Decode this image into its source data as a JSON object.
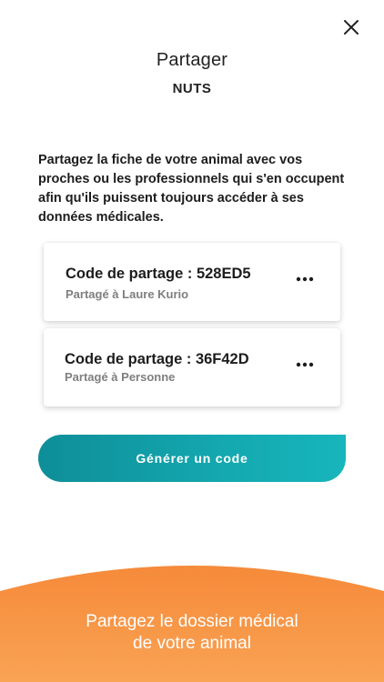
{
  "header": {
    "title": "Partager",
    "pet_name": "NUTS",
    "close_icon": "close-icon"
  },
  "description": "Partagez la fiche de votre animal avec vos proches ou les professionnels qui s'en occupent afin qu'ils puissent toujours accéder à ses données médicales.",
  "share_codes": [
    {
      "code_label": "Code de partage : 528ED5",
      "shared_with": "Partagé à Laure Kurio",
      "menu_icon": "more-icon"
    },
    {
      "code_label": "Code de partage : 36F42D",
      "shared_with": "Partagé à Personne",
      "menu_icon": "more-icon"
    }
  ],
  "generate_button": {
    "label": "Générer un code"
  },
  "banner": {
    "line1": "Partagez le dossier médical",
    "line2": "de votre animal"
  },
  "colors": {
    "accent_teal": "#14a8b0",
    "banner_orange": "#f5903e",
    "text_dark": "#1d1d1d",
    "text_muted": "#7f7f7f"
  }
}
